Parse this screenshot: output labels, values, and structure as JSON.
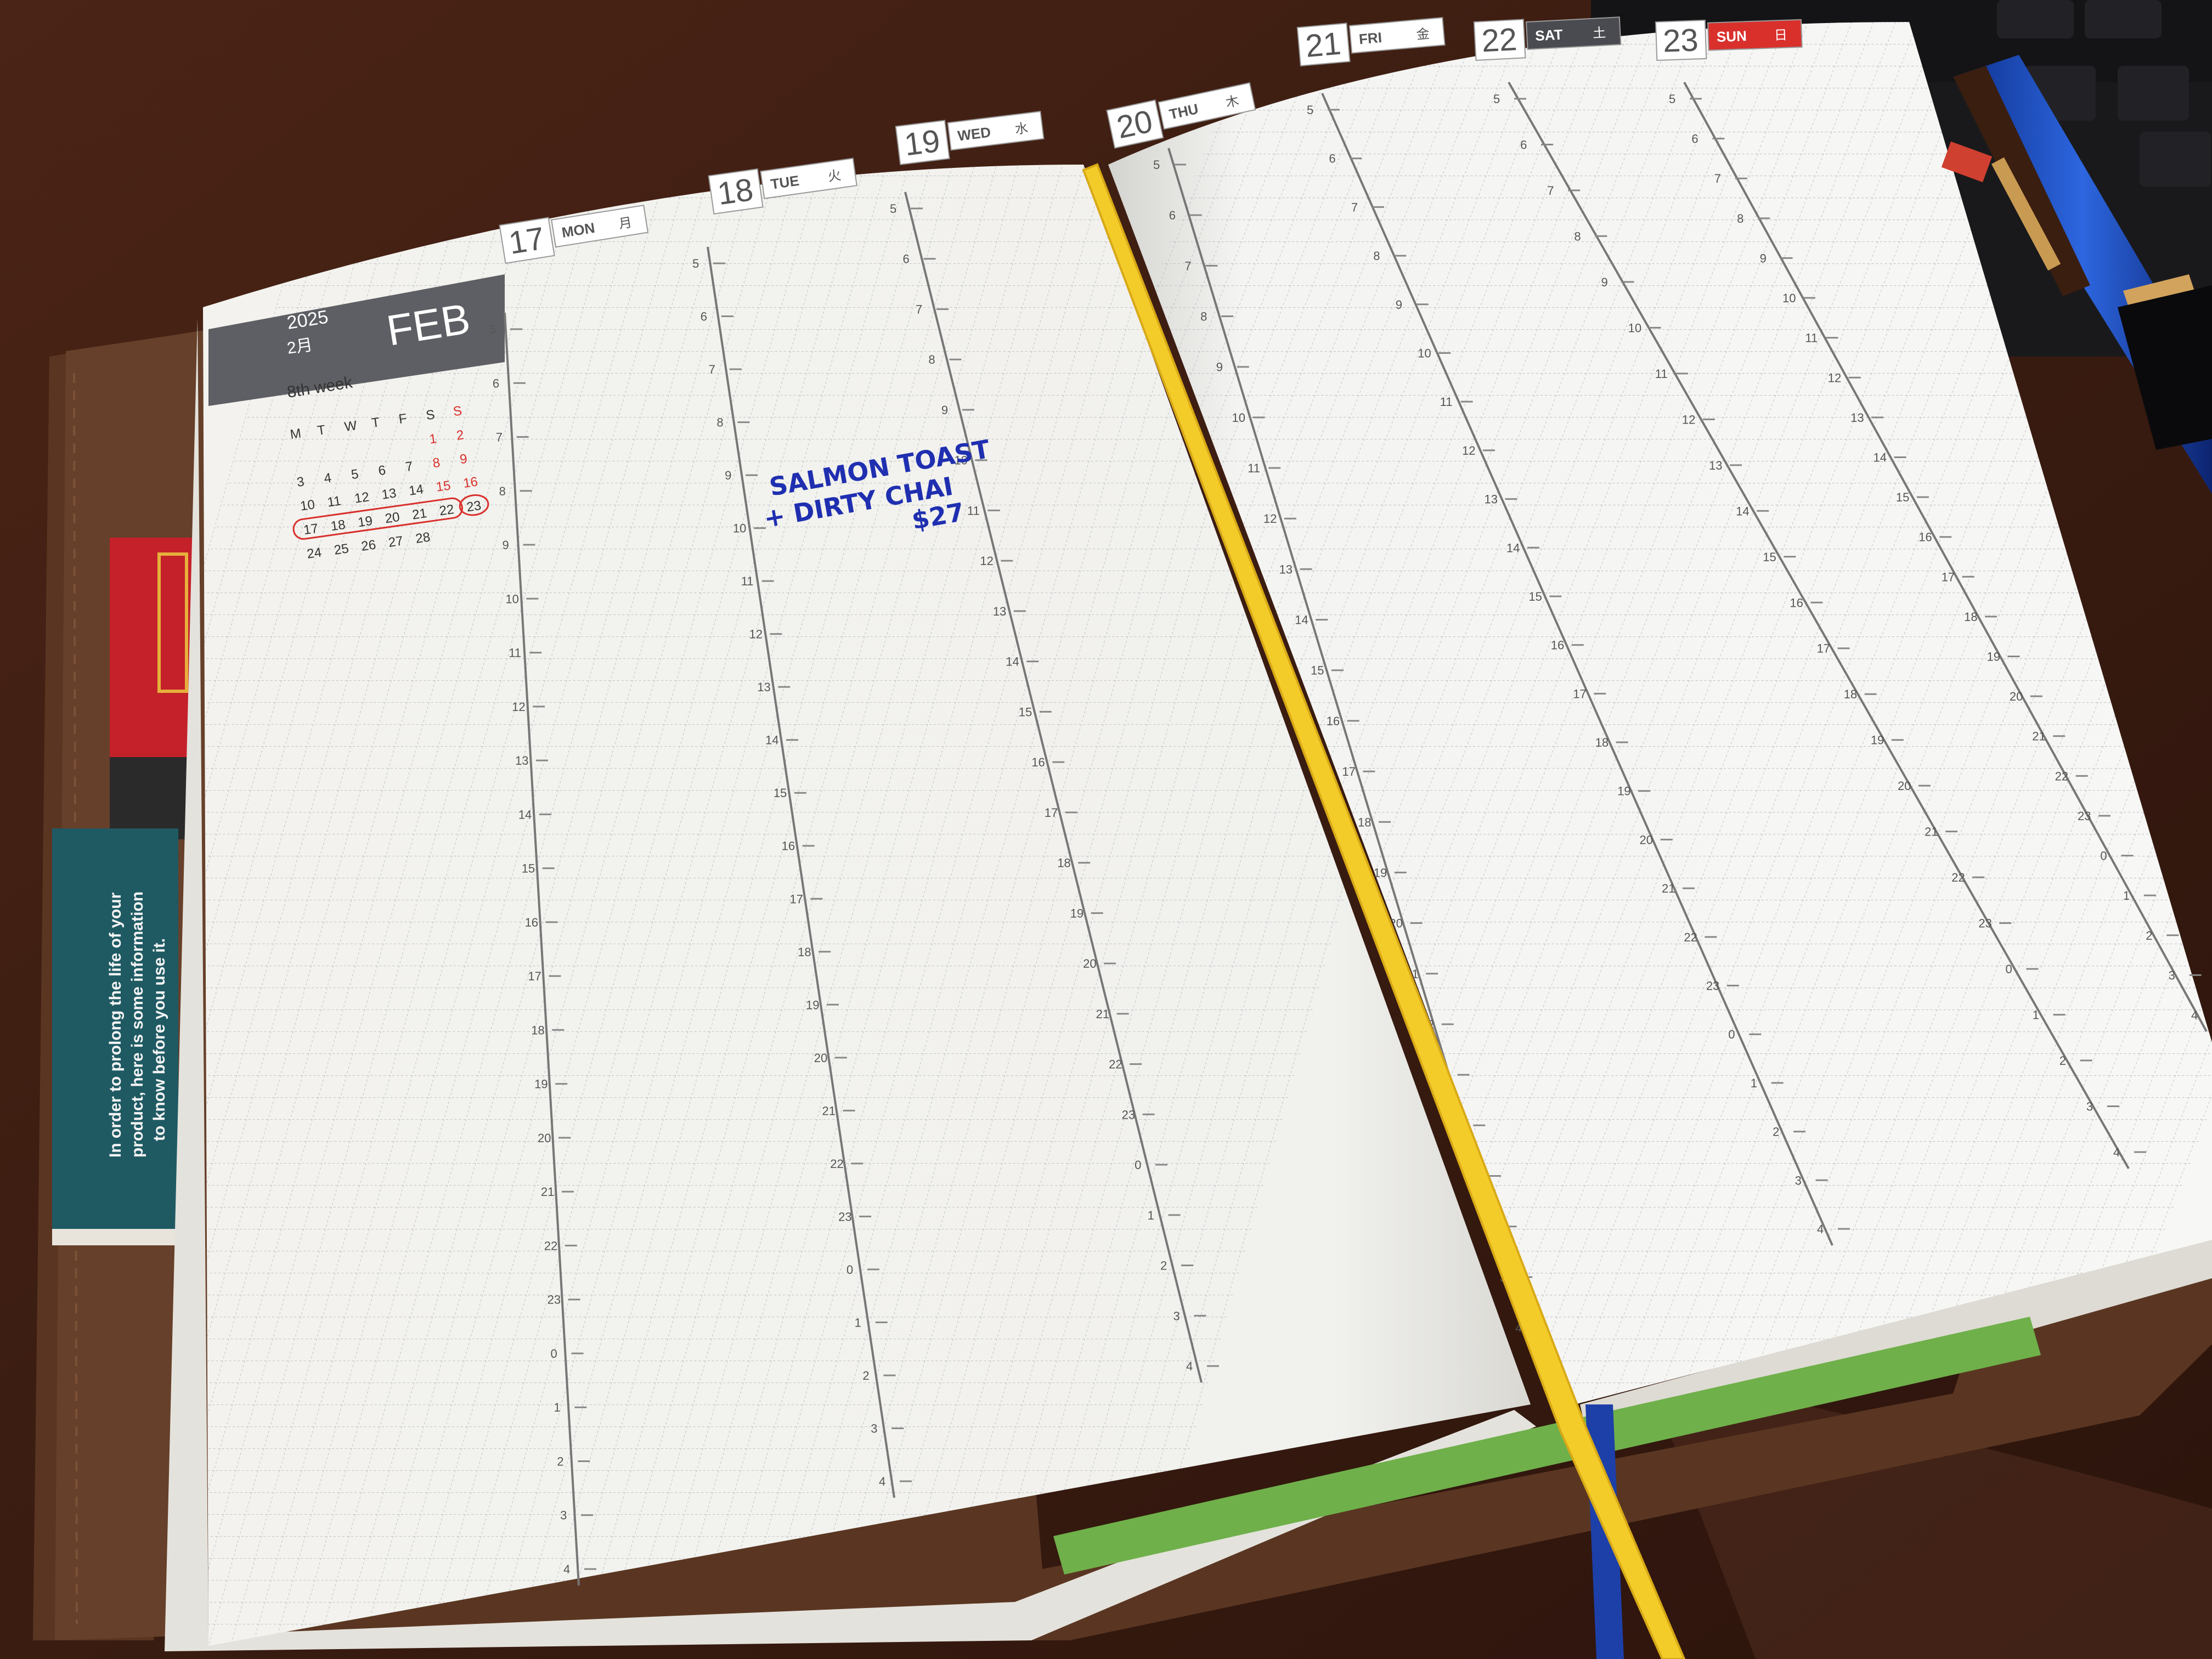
{
  "header": {
    "year": "2025",
    "month_jp": "2月",
    "month": "FEB",
    "week_label": "8th week"
  },
  "mini_calendar": {
    "weekdays": [
      "M",
      "T",
      "W",
      "T",
      "F",
      "S",
      "S"
    ],
    "rows": [
      [
        "",
        "",
        "",
        "",
        "",
        "1",
        "2"
      ],
      [
        "3",
        "4",
        "5",
        "6",
        "7",
        "8",
        "9"
      ],
      [
        "10",
        "11",
        "12",
        "13",
        "14",
        "15",
        "16"
      ],
      [
        "17",
        "18",
        "19",
        "20",
        "21",
        "22",
        "23"
      ],
      [
        "24",
        "25",
        "26",
        "27",
        "28",
        "",
        ""
      ]
    ],
    "highlighted_week": 3,
    "circled_day": "23"
  },
  "days": [
    {
      "num": "17",
      "dow": "MON",
      "kanji": "月"
    },
    {
      "num": "18",
      "dow": "TUE",
      "kanji": "火"
    },
    {
      "num": "19",
      "dow": "WED",
      "kanji": "水"
    },
    {
      "num": "20",
      "dow": "THU",
      "kanji": "木"
    },
    {
      "num": "21",
      "dow": "FRI",
      "kanji": "金"
    },
    {
      "num": "22",
      "dow": "SAT",
      "kanji": "土"
    },
    {
      "num": "23",
      "dow": "SUN",
      "kanji": "日"
    }
  ],
  "hours": [
    "5",
    "6",
    "7",
    "8",
    "9",
    "10",
    "11",
    "12",
    "13",
    "14",
    "15",
    "16",
    "17",
    "18",
    "19",
    "20",
    "21",
    "22",
    "23",
    "0",
    "1",
    "2",
    "3",
    "4"
  ],
  "handwriting": {
    "line1": "SALMON TOAST",
    "line2": "+ DIRTY CHAI",
    "line3": "$27",
    "ink_color": "#1f2fb0"
  },
  "insert_card": {
    "line1": "In order to prolong the life of your",
    "line2": "product, here is some information",
    "line3": "to know before you use it."
  },
  "colors": {
    "header_gray": "#5e5f64",
    "sunday_red": "#d9302c",
    "saturday_dark": "#4a4b50",
    "ribbon_yellow": "#f4cc2a",
    "ribbon_blue": "#1d3fa8",
    "cover_brown": "#5a3622",
    "card_teal": "#1f5a63"
  }
}
